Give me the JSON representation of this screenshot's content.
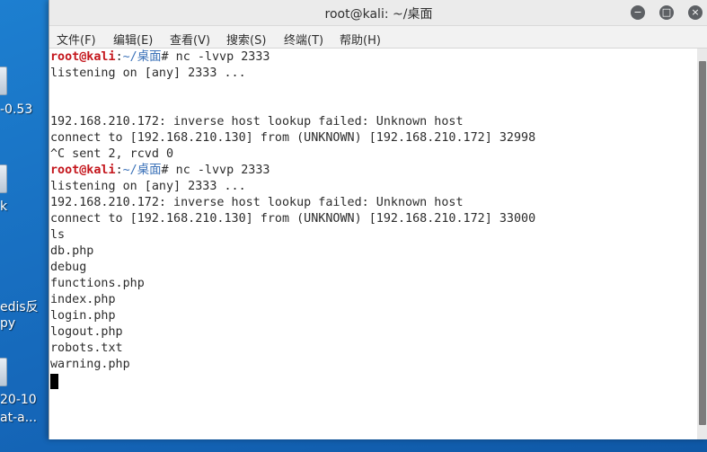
{
  "desktop": {
    "icons": [
      {
        "label": "-0.53"
      },
      {
        "label": "k"
      },
      {
        "label": "edis反"
      },
      {
        "label": "py"
      },
      {
        "label": "20-10"
      },
      {
        "label": "at-a..."
      }
    ]
  },
  "window": {
    "title": "root@kali: ~/桌面",
    "buttons": {
      "minimize": "−",
      "maximize": "□",
      "close": "×"
    }
  },
  "menu": [
    "文件(F)",
    "编辑(E)",
    "查看(V)",
    "搜索(S)",
    "终端(T)",
    "帮助(H)"
  ],
  "terminal": {
    "prompt1": {
      "user": "root@kali",
      "colon": ":",
      "path": "~/桌面",
      "cmd": "# nc -lvvp 2333"
    },
    "l2": "listening on [any] 2333 ...",
    "l5": "192.168.210.172: inverse host lookup failed: Unknown host",
    "l6": "connect to [192.168.210.130] from (UNKNOWN) [192.168.210.172] 32998",
    "l7": "^C sent 2, rcvd 0",
    "prompt2": {
      "user": "root@kali",
      "colon": ":",
      "path": "~/桌面",
      "cmd": "# nc -lvvp 2333"
    },
    "l9": "listening on [any] 2333 ...",
    "l10": "192.168.210.172: inverse host lookup failed: Unknown host",
    "l11": "connect to [192.168.210.130] from (UNKNOWN) [192.168.210.172] 33000",
    "l12": "ls",
    "files": [
      "db.php",
      "debug",
      "functions.php",
      "index.php",
      "login.php",
      "logout.php",
      "robots.txt",
      "warning.php"
    ]
  },
  "colors": {
    "prompt_user": "#c4161c",
    "prompt_path": "#3d73b9",
    "desktop_bg": "#1566b8"
  }
}
